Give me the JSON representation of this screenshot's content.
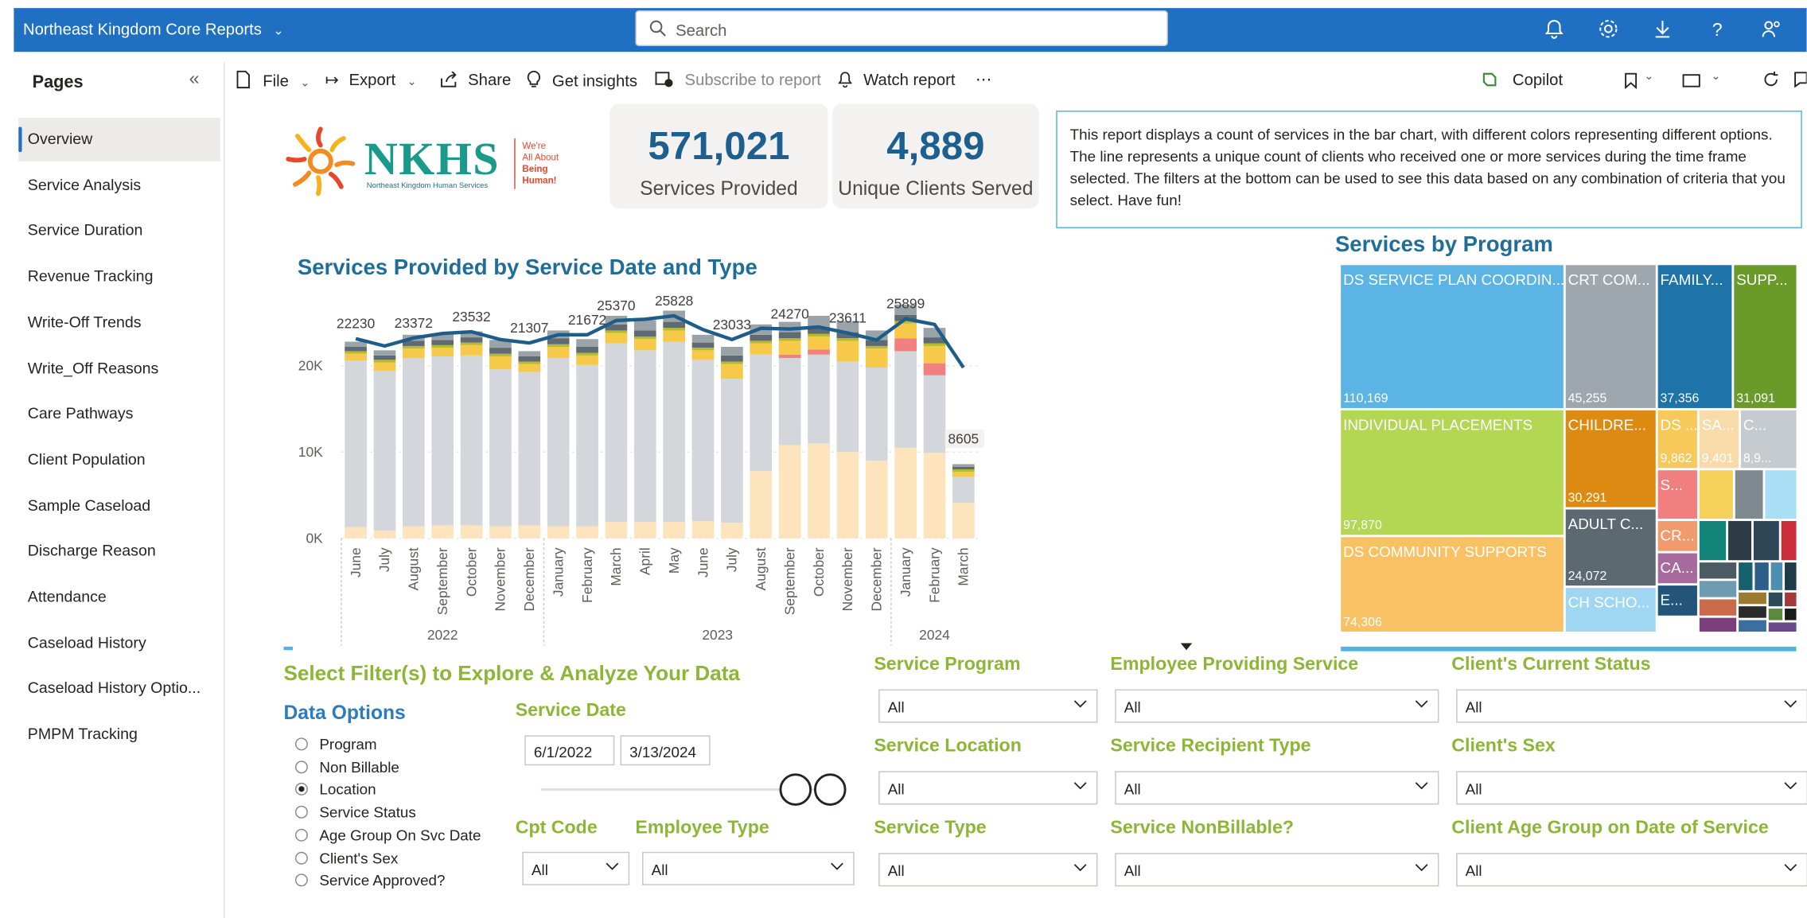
{
  "app": {
    "title": "Northeast Kingdom Core Reports",
    "search_placeholder": "Search"
  },
  "pages": {
    "title": "Pages",
    "items": [
      "Overview",
      "Service Analysis",
      "Service Duration",
      "Revenue Tracking",
      "Write-Off Trends",
      "Write_Off Reasons",
      "Care Pathways",
      "Client Population",
      "Sample Caseload",
      "Discharge Reason",
      "Attendance",
      "Caseload History",
      "Caseload History Optio...",
      "PMPM Tracking"
    ]
  },
  "toolbar": {
    "file": "File",
    "export": "Export",
    "share": "Share",
    "insights": "Get insights",
    "subscribe": "Subscribe to report",
    "watch": "Watch report",
    "more": "⋯",
    "copilot": "Copilot"
  },
  "logo": {
    "name": "NKHS",
    "sub": "Northeast Kingdom Human Services",
    "tag1": "We're",
    "tag2": "All About",
    "tag3": "Being",
    "tag4": "Human!"
  },
  "kpis": [
    {
      "value": "571,021",
      "label": "Services Provided"
    },
    {
      "value": "4,889",
      "label": "Unique Clients Served"
    }
  ],
  "description": "This report displays a count of services in the bar chart, with different colors representing different options.  The line represents a unique count of clients who received one or more services during the time frame selected.  The filters at the bottom can be used to see this data based on any combination of criteria that you select.  Have fun!",
  "chart_data": [
    {
      "type": "bar",
      "title": "Services Provided by Service Date and Type",
      "stacked": true,
      "y_ticks": [
        "0K",
        "10K",
        "20K"
      ],
      "ylim": [
        0,
        27000
      ],
      "categories": [
        "June",
        "July",
        "August",
        "September",
        "October",
        "November",
        "December",
        "January",
        "February",
        "March",
        "April",
        "May",
        "June",
        "July",
        "August",
        "September",
        "October",
        "November",
        "December",
        "January",
        "February",
        "March"
      ],
      "years": [
        {
          "label": "2022",
          "from": 0,
          "to": 6
        },
        {
          "label": "2023",
          "from": 7,
          "to": 18
        },
        {
          "label": "2024",
          "from": 19,
          "to": 21
        }
      ],
      "series": [
        {
          "color": "#fde4bd",
          "values": [
            1300,
            900,
            1400,
            1500,
            1500,
            1400,
            1500,
            1400,
            1400,
            1900,
            1900,
            1900,
            2000,
            1800,
            7800,
            10800,
            11000,
            10000,
            9000,
            10500,
            9900,
            4100
          ]
        },
        {
          "color": "#d3d6da",
          "values": [
            19300,
            18500,
            19500,
            19600,
            19700,
            18200,
            17800,
            19500,
            18700,
            20700,
            19900,
            20900,
            18700,
            16700,
            13500,
            10100,
            10300,
            10500,
            10800,
            11200,
            9000,
            3000
          ]
        },
        {
          "color": "#f18180",
          "values": [
            0,
            0,
            0,
            0,
            0,
            0,
            0,
            0,
            0,
            0,
            0,
            0,
            0,
            0,
            0,
            400,
            600,
            0,
            0,
            1500,
            1400,
            0
          ]
        },
        {
          "color": "#f7c948",
          "values": [
            800,
            1000,
            1100,
            1000,
            1200,
            1500,
            900,
            1300,
            1100,
            1200,
            1300,
            1300,
            1100,
            1700,
            1300,
            1600,
            1500,
            2400,
            2200,
            1700,
            2000,
            600
          ]
        },
        {
          "color": "#b6bb2e",
          "values": [
            300,
            300,
            300,
            300,
            300,
            300,
            300,
            300,
            300,
            300,
            300,
            300,
            300,
            300,
            300,
            300,
            300,
            300,
            300,
            300,
            300,
            300
          ]
        },
        {
          "color": "#5f6a72",
          "values": [
            500,
            500,
            600,
            600,
            600,
            700,
            600,
            700,
            700,
            700,
            700,
            700,
            600,
            700,
            700,
            700,
            800,
            700,
            700,
            700,
            700,
            300
          ]
        },
        {
          "color": "#9aa3a8",
          "values": [
            600,
            600,
            700,
            700,
            700,
            900,
            600,
            900,
            900,
            1000,
            1200,
            1300,
            900,
            1000,
            1200,
            1200,
            1300,
            1300,
            1100,
            1200,
            1100,
            300
          ]
        }
      ],
      "line": {
        "color": "#1e5c89",
        "values": [
          23150,
          22300,
          23230,
          23750,
          23950,
          23050,
          22650,
          23600,
          23600,
          25250,
          25400,
          25800,
          24200,
          23050,
          24350,
          24270,
          24500,
          23800,
          23000,
          25450,
          24800,
          19800
        ]
      },
      "data_labels": [
        {
          "i": 0,
          "text": "22230"
        },
        {
          "i": 2,
          "text": "23372"
        },
        {
          "i": 4,
          "text": "23532"
        },
        {
          "i": 6,
          "text": "21307"
        },
        {
          "i": 8,
          "text": "21672"
        },
        {
          "i": 9,
          "text": "25370"
        },
        {
          "i": 11,
          "text": "25828"
        },
        {
          "i": 13,
          "text": "23033"
        },
        {
          "i": 15,
          "text": "24270"
        },
        {
          "i": 17,
          "text": "23611"
        },
        {
          "i": 19,
          "text": "25899"
        },
        {
          "i": 21,
          "text": "8605"
        }
      ]
    },
    {
      "type": "treemap",
      "title": "Services by Program",
      "items": [
        {
          "label": "DS SERVICE PLAN COORDIN...",
          "value": "110,169",
          "color": "#5bb4e3"
        },
        {
          "label": "CRT COM...",
          "value": "45,255",
          "color": "#9ea7ad"
        },
        {
          "label": "FAMILY...",
          "value": "37,356",
          "color": "#1e73a8"
        },
        {
          "label": "SUPP...",
          "value": "31,091",
          "color": "#6a9a2a"
        },
        {
          "label": "INDIVIDUAL PLACEMENTS",
          "value": "97,870",
          "color": "#b3d653"
        },
        {
          "label": "CHILDRE...",
          "value": "30,291",
          "color": "#dd8a12"
        },
        {
          "label": "DS ...",
          "value": "9,862",
          "color": "#f6c95a"
        },
        {
          "label": "SA...",
          "value": "9,401",
          "color": "#f8dba8"
        },
        {
          "label": "C...",
          "value": "8,9...",
          "color": "#c5cbce"
        },
        {
          "label": "DS COMMUNITY SUPPORTS",
          "value": "74,306",
          "color": "#f8c264"
        },
        {
          "label": "ADULT C...",
          "value": "24,072",
          "color": "#5d6971"
        },
        {
          "label": "CH SCHO...",
          "value": "",
          "color": "#9fd7f2"
        },
        {
          "label": "S...",
          "value": "",
          "color": "#f17f80"
        },
        {
          "label": "CR...",
          "value": "",
          "color": "#f19a6b"
        },
        {
          "label": "CA...",
          "value": "",
          "color": "#a66a9e"
        },
        {
          "label": "E...",
          "value": "",
          "color": "#23557b"
        }
      ]
    }
  ],
  "filters": {
    "title": "Select Filter(s) to Explore & Analyze Your Data",
    "data_options_title": "Data Options",
    "data_options": [
      "Program",
      "Non Billable",
      "Location",
      "Service Status",
      "Age Group On Svc Date",
      "Client's Sex",
      "Service Approved?"
    ],
    "data_options_selected": 2,
    "service_date": {
      "label": "Service Date",
      "from": "6/1/2022",
      "to": "3/13/2024"
    },
    "cpt_code": {
      "label": "Cpt Code",
      "value": "All"
    },
    "employee_type": {
      "label": "Employee Type",
      "value": "All"
    },
    "dropdowns": [
      {
        "label": "Service Program",
        "value": "All"
      },
      {
        "label": "Employee Providing Service",
        "value": "All"
      },
      {
        "label": "Client's Current Status",
        "value": "All"
      },
      {
        "label": "Service Location",
        "value": "All"
      },
      {
        "label": "Service Recipient Type",
        "value": "All"
      },
      {
        "label": "Client's Sex",
        "value": "All"
      },
      {
        "label": "Service Type",
        "value": "All"
      },
      {
        "label": "Service NonBillable?",
        "value": "All"
      },
      {
        "label": "Client Age Group on Date of Service",
        "value": "All"
      }
    ]
  }
}
